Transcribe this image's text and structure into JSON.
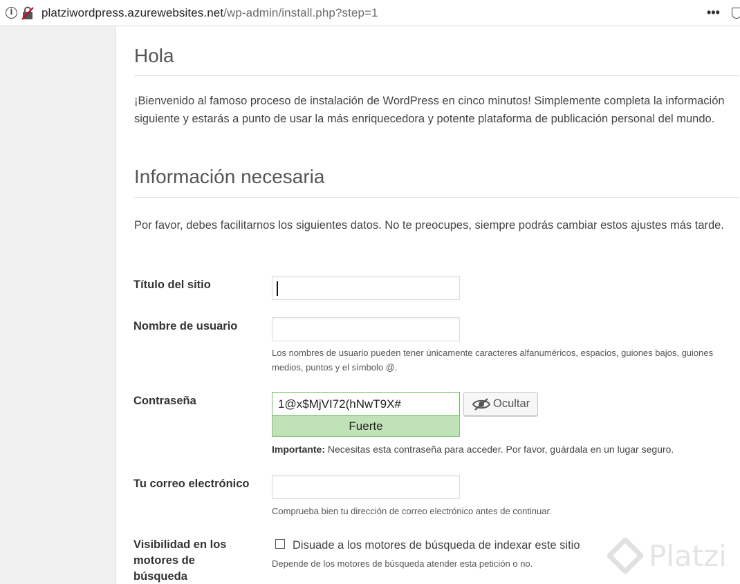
{
  "browser": {
    "url_host": "platziwordpress.azurewebsites.net",
    "url_path": "/wp-admin/install.php?step=1",
    "menu_glyph": "•••",
    "icons": [
      "info-icon",
      "insecure-lock-icon",
      "more-icon",
      "shield-icon"
    ]
  },
  "page": {
    "greeting_title": "Hola",
    "welcome_text": "¡Bienvenido al famoso proceso de instalación de WordPress en cinco minutos! Simplemente completa la información siguiente y estarás a punto de usar la más enriquecedora y potente plataforma de publicación personal del mundo.",
    "info_title": "Información necesaria",
    "info_intro": "Por favor, debes facilitarnos los siguientes datos. No te preocupes, siempre podrás cambiar estos ajustes más tarde."
  },
  "form": {
    "site_title": {
      "label": "Título del sitio",
      "value": ""
    },
    "username": {
      "label": "Nombre de usuario",
      "value": "",
      "help": "Los nombres de usuario pueden tener únicamente caracteres alfanuméricos, espacios, guiones bajos, guiones medios, puntos y el símbolo @."
    },
    "password": {
      "label": "Contraseña",
      "value": "1@x$MjVI72(hNwT9X#",
      "strength": "Fuerte",
      "hide_button": "Ocultar",
      "important_label": "Importante:",
      "important_text": " Necesitas esta contraseña para acceder. Por favor, guárdala en un lugar seguro."
    },
    "email": {
      "label": "Tu correo electrónico",
      "value": "",
      "help": "Comprueba bien tu dirección de correo electrónico antes de continuar."
    },
    "visibility": {
      "label": "Visibilidad en los motores de búsqueda",
      "checkbox_label": "Disuade a los motores de búsqueda de indexar este sitio",
      "checked": false,
      "help": "Depende de los motores de búsqueda atender esta petición o no."
    }
  },
  "watermark": {
    "text": "Platzi"
  },
  "colors": {
    "strong_bg": "#c1e1b9",
    "strong_border": "#83c373",
    "page_bg": "#f1f1f1",
    "card_bg": "#ffffff"
  }
}
